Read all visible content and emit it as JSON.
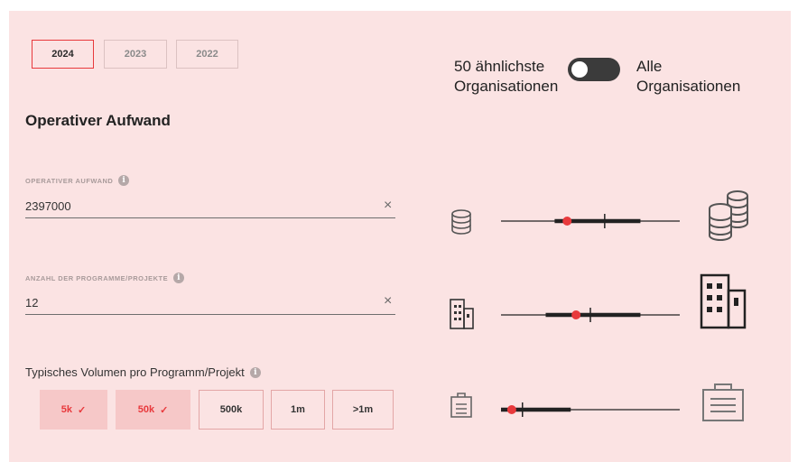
{
  "years": [
    {
      "label": "2024",
      "active": true
    },
    {
      "label": "2023",
      "active": false
    },
    {
      "label": "2022",
      "active": false
    }
  ],
  "comparison_toggle": {
    "left_label_line1": "50 ähnlichste",
    "left_label_line2": "Organisationen",
    "right_label_line1": "Alle",
    "right_label_line2": "Organisationen",
    "state": "off"
  },
  "section_title": "Operativer Aufwand",
  "fields": [
    {
      "label": "OPERATIVER AUFWAND",
      "value": "2397000",
      "info_icon": "i"
    },
    {
      "label": "ANZAHL DER PROGRAMME/PROJEKTE",
      "value": "12",
      "info_icon": "i"
    }
  ],
  "clear_symbol": "×",
  "volume": {
    "label": "Typisches Volumen pro Programm/Projekt",
    "info_icon": "i",
    "check_symbol": "✓",
    "options": [
      {
        "label": "5k",
        "selected": true
      },
      {
        "label": "50k",
        "selected": true
      },
      {
        "label": "500k",
        "selected": false
      },
      {
        "label": "1m",
        "selected": false
      },
      {
        "label": ">1m",
        "selected": false
      }
    ]
  },
  "scales": [
    {
      "name": "operativer-aufwand",
      "small_icon": "coins-small-icon",
      "large_icon": "coins-large-icon",
      "marker_position": 0.37,
      "median_position": 0.58,
      "range": [
        0.3,
        0.78
      ]
    },
    {
      "name": "anzahl-programme",
      "small_icon": "building-small-icon",
      "large_icon": "building-large-icon",
      "marker_position": 0.42,
      "median_position": 0.5,
      "range": [
        0.25,
        0.78
      ]
    },
    {
      "name": "volumen",
      "small_icon": "briefcase-small-icon",
      "large_icon": "briefcase-large-icon",
      "marker_position": 0.06,
      "median_position": 0.12,
      "range": [
        0.0,
        0.39
      ]
    }
  ],
  "colors": {
    "accent": "#e8393c",
    "background": "#fbe3e3",
    "dark": "#222222"
  }
}
